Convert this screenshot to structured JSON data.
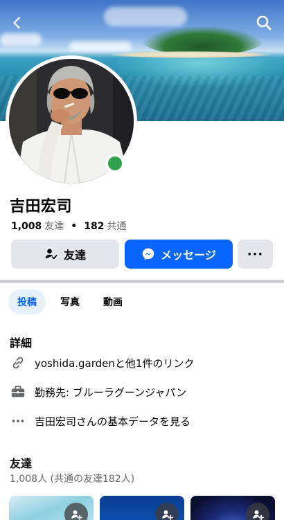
{
  "profile": {
    "name": "吉田宏司",
    "friends_count": "1,008",
    "friends_label": "友達",
    "mutual_count": "182",
    "mutual_label": "共通",
    "online": true
  },
  "actions": {
    "friends_label": "友達",
    "message_label": "メッセージ",
    "more_label": "···"
  },
  "tabs": [
    {
      "label": "投稿",
      "active": true
    },
    {
      "label": "写真",
      "active": false
    },
    {
      "label": "動画",
      "active": false
    }
  ],
  "details": {
    "title": "詳細",
    "link_text": "yoshida.gardenと他1件のリンク",
    "work_text": "勤務先: ブルーラグーンジャパン",
    "basic_info_text": "吉田宏司さんの基本データを見る"
  },
  "friends_section": {
    "title": "友達",
    "subtitle": "1,008人 (共通の友達182人)"
  },
  "colors": {
    "accent": "#0866ff",
    "online": "#31a24c",
    "secondary_text": "#65676b",
    "button_gray": "#e4e6eb"
  },
  "icons": {
    "back": "chevron-left-icon",
    "search": "search-icon",
    "link": "link-icon",
    "work": "briefcase-icon",
    "more_info": "ellipsis-icon",
    "friends": "user-check-icon",
    "messenger": "messenger-icon",
    "add_friend": "add-friend-icon"
  }
}
